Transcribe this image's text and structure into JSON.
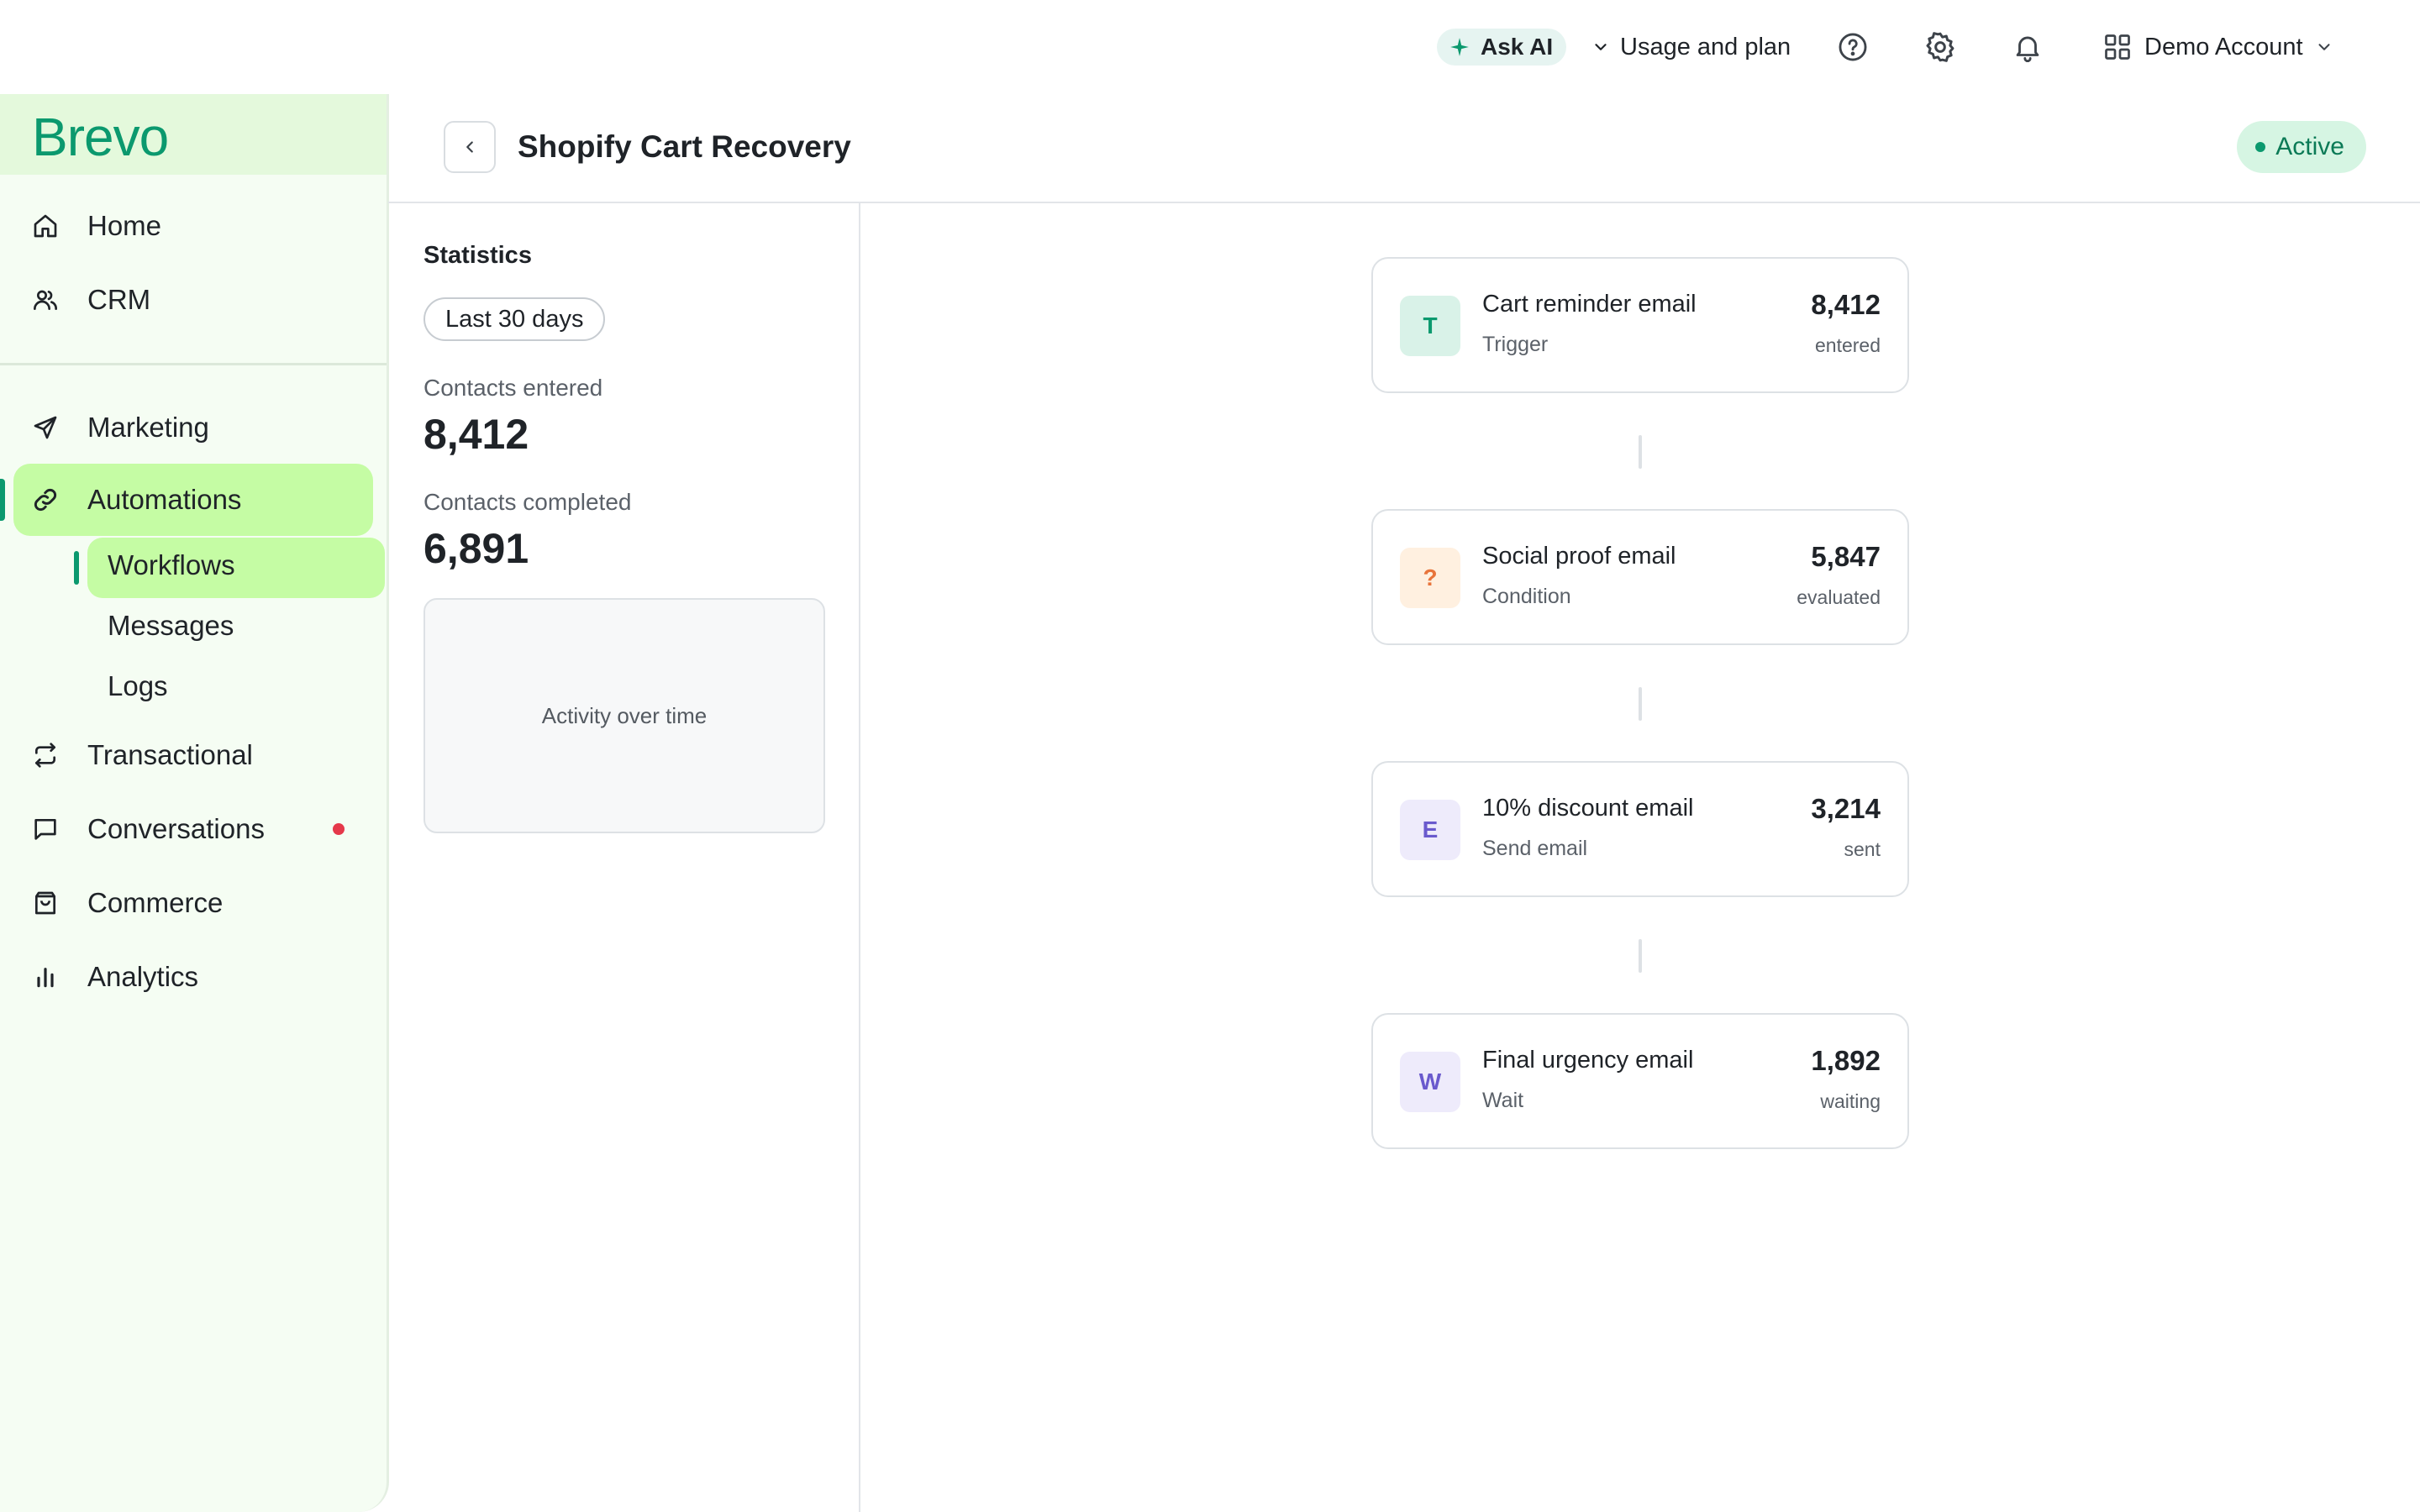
{
  "topbar": {
    "ask_ai": "Ask AI",
    "usage": "Usage and plan",
    "account": "Demo Account"
  },
  "sidebar": {
    "logo": "Brevo",
    "items": [
      {
        "label": "Home",
        "icon": "home-icon"
      },
      {
        "label": "CRM",
        "icon": "users-icon"
      },
      {
        "label": "Marketing",
        "icon": "send-icon"
      },
      {
        "label": "Automations",
        "icon": "link-icon"
      },
      {
        "label": "Transactional",
        "icon": "repeat-icon"
      },
      {
        "label": "Conversations",
        "icon": "chat-icon"
      },
      {
        "label": "Commerce",
        "icon": "bag-icon"
      },
      {
        "label": "Analytics",
        "icon": "bar-chart-icon"
      }
    ],
    "subitems": [
      {
        "label": "Workflows"
      },
      {
        "label": "Messages"
      },
      {
        "label": "Logs"
      }
    ]
  },
  "header": {
    "title": "Shopify Cart Recovery",
    "status": "Active"
  },
  "stats": {
    "title": "Statistics",
    "period": "Last 30 days",
    "entered_label": "Contacts entered",
    "entered_value": "8,412",
    "completed_label": "Contacts completed",
    "completed_value": "6,891",
    "activity_label": "Activity over time"
  },
  "workflow": {
    "nodes": [
      {
        "badge": "T",
        "name": "Cart reminder email",
        "type": "Trigger",
        "count": "8,412",
        "unit": "entered"
      },
      {
        "badge": "?",
        "name": "Social proof email",
        "type": "Condition",
        "count": "5,847",
        "unit": "evaluated"
      },
      {
        "badge": "E",
        "name": "10% discount email",
        "type": "Send email",
        "count": "3,214",
        "unit": "sent"
      },
      {
        "badge": "W",
        "name": "Final urgency email",
        "type": "Wait",
        "count": "1,892",
        "unit": "waiting"
      }
    ]
  },
  "colors": {
    "brand": "#0b996e",
    "nav_active": "#c5fca4",
    "sidebar_bg": "#f5fdf3",
    "notification_dot": "#e5384a",
    "status_bg": "#d6f5e3"
  }
}
